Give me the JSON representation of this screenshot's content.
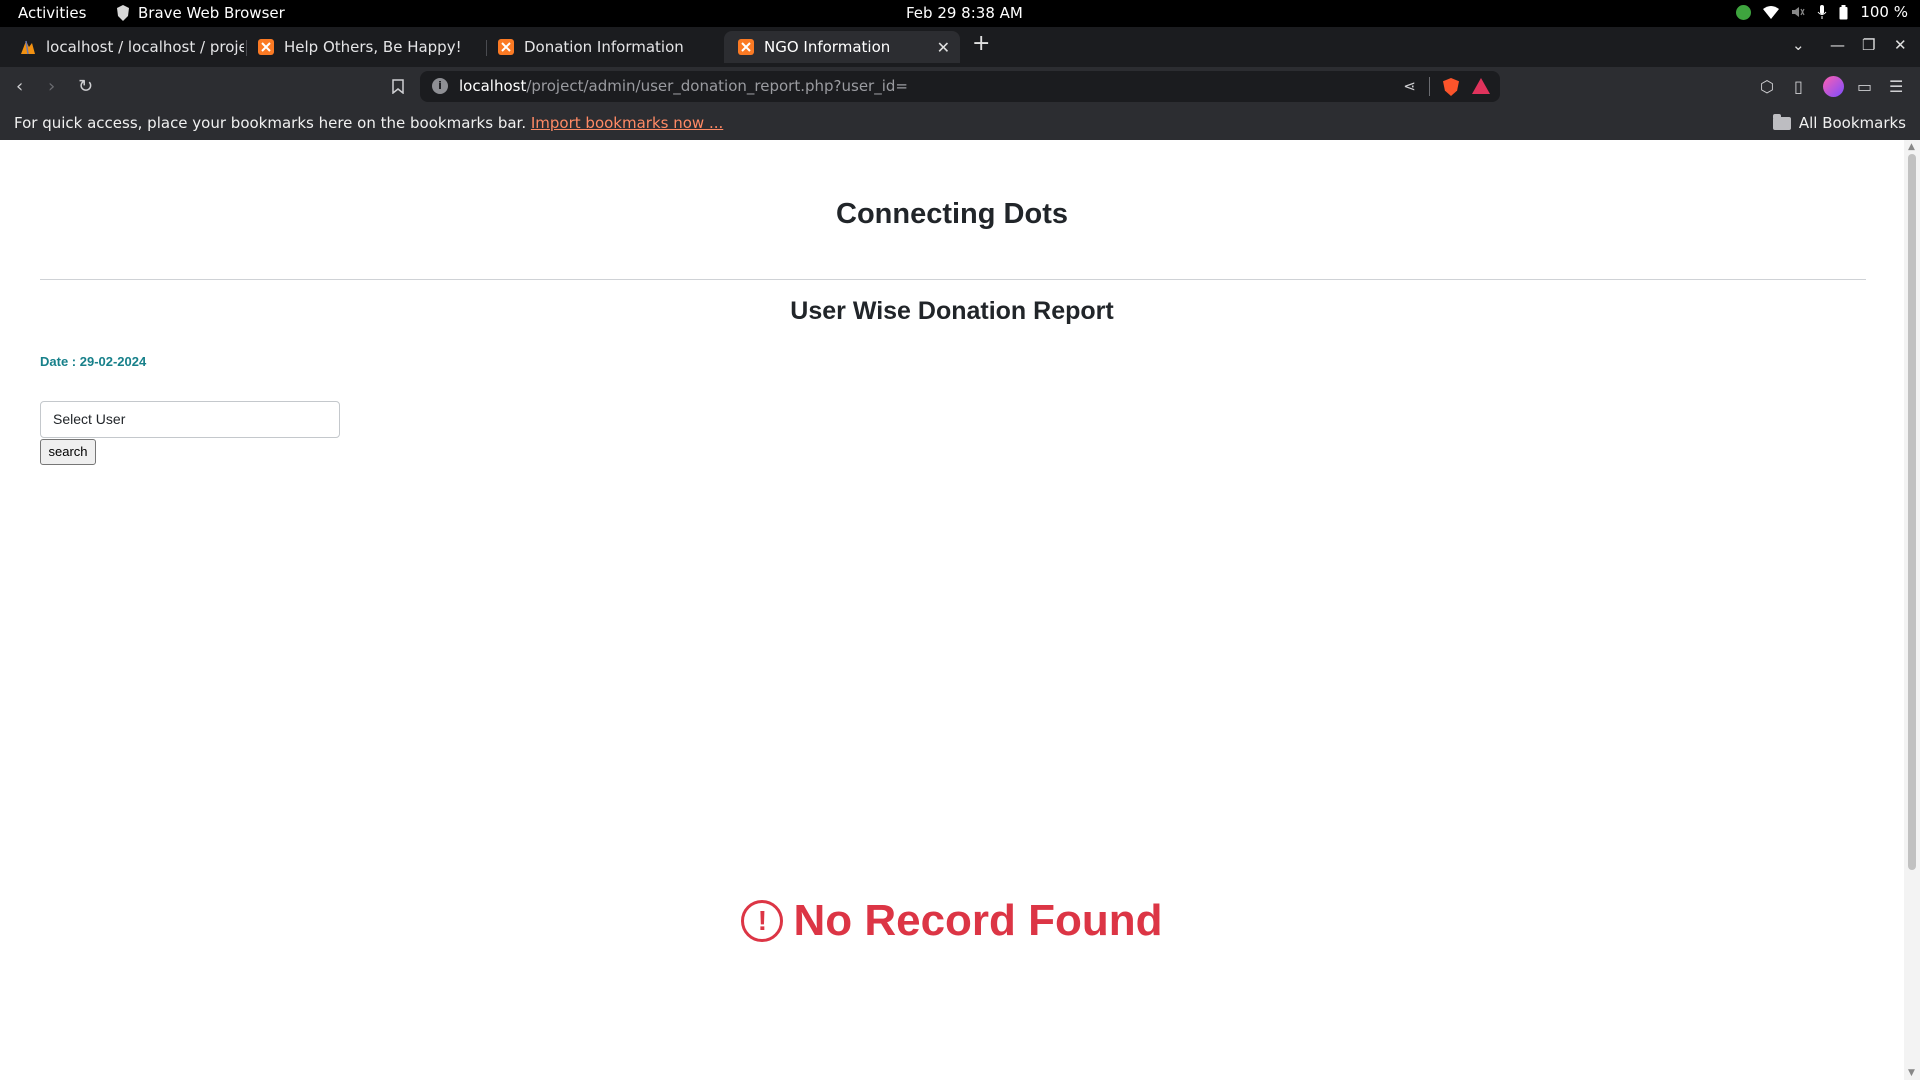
{
  "system_bar": {
    "activities": "Activities",
    "app_name": "Brave Web Browser",
    "clock": "Feb 29  8:38 AM",
    "battery": "100 %"
  },
  "tabs": [
    {
      "label": "localhost / localhost / projec",
      "icon": "phpmyadmin-icon",
      "active": false
    },
    {
      "label": "Help Others, Be Happy!",
      "icon": "xampp-icon",
      "active": false
    },
    {
      "label": "Donation Information",
      "icon": "xampp-icon",
      "active": false
    },
    {
      "label": "NGO Information",
      "icon": "xampp-icon",
      "active": true
    }
  ],
  "address_bar": {
    "host": "localhost",
    "path": "/project/admin/user_donation_report.php?user_id="
  },
  "bookmarks_bar": {
    "hint": "For quick access, place your bookmarks here on the bookmarks bar.",
    "import_link": "Import bookmarks now ...",
    "all_bookmarks": "All Bookmarks"
  },
  "page": {
    "site_title": "Connecting Dots",
    "report_title": "User Wise Donation Report",
    "date_label": "Date : 29-02-2024",
    "select_user_placeholder": "Select User",
    "search_button": "search",
    "no_record": "No Record Found"
  },
  "colors": {
    "accent_teal": "#17808a",
    "error_red": "#dc3545",
    "brave_orange": "#fb542b",
    "import_link": "#ff8a65"
  }
}
